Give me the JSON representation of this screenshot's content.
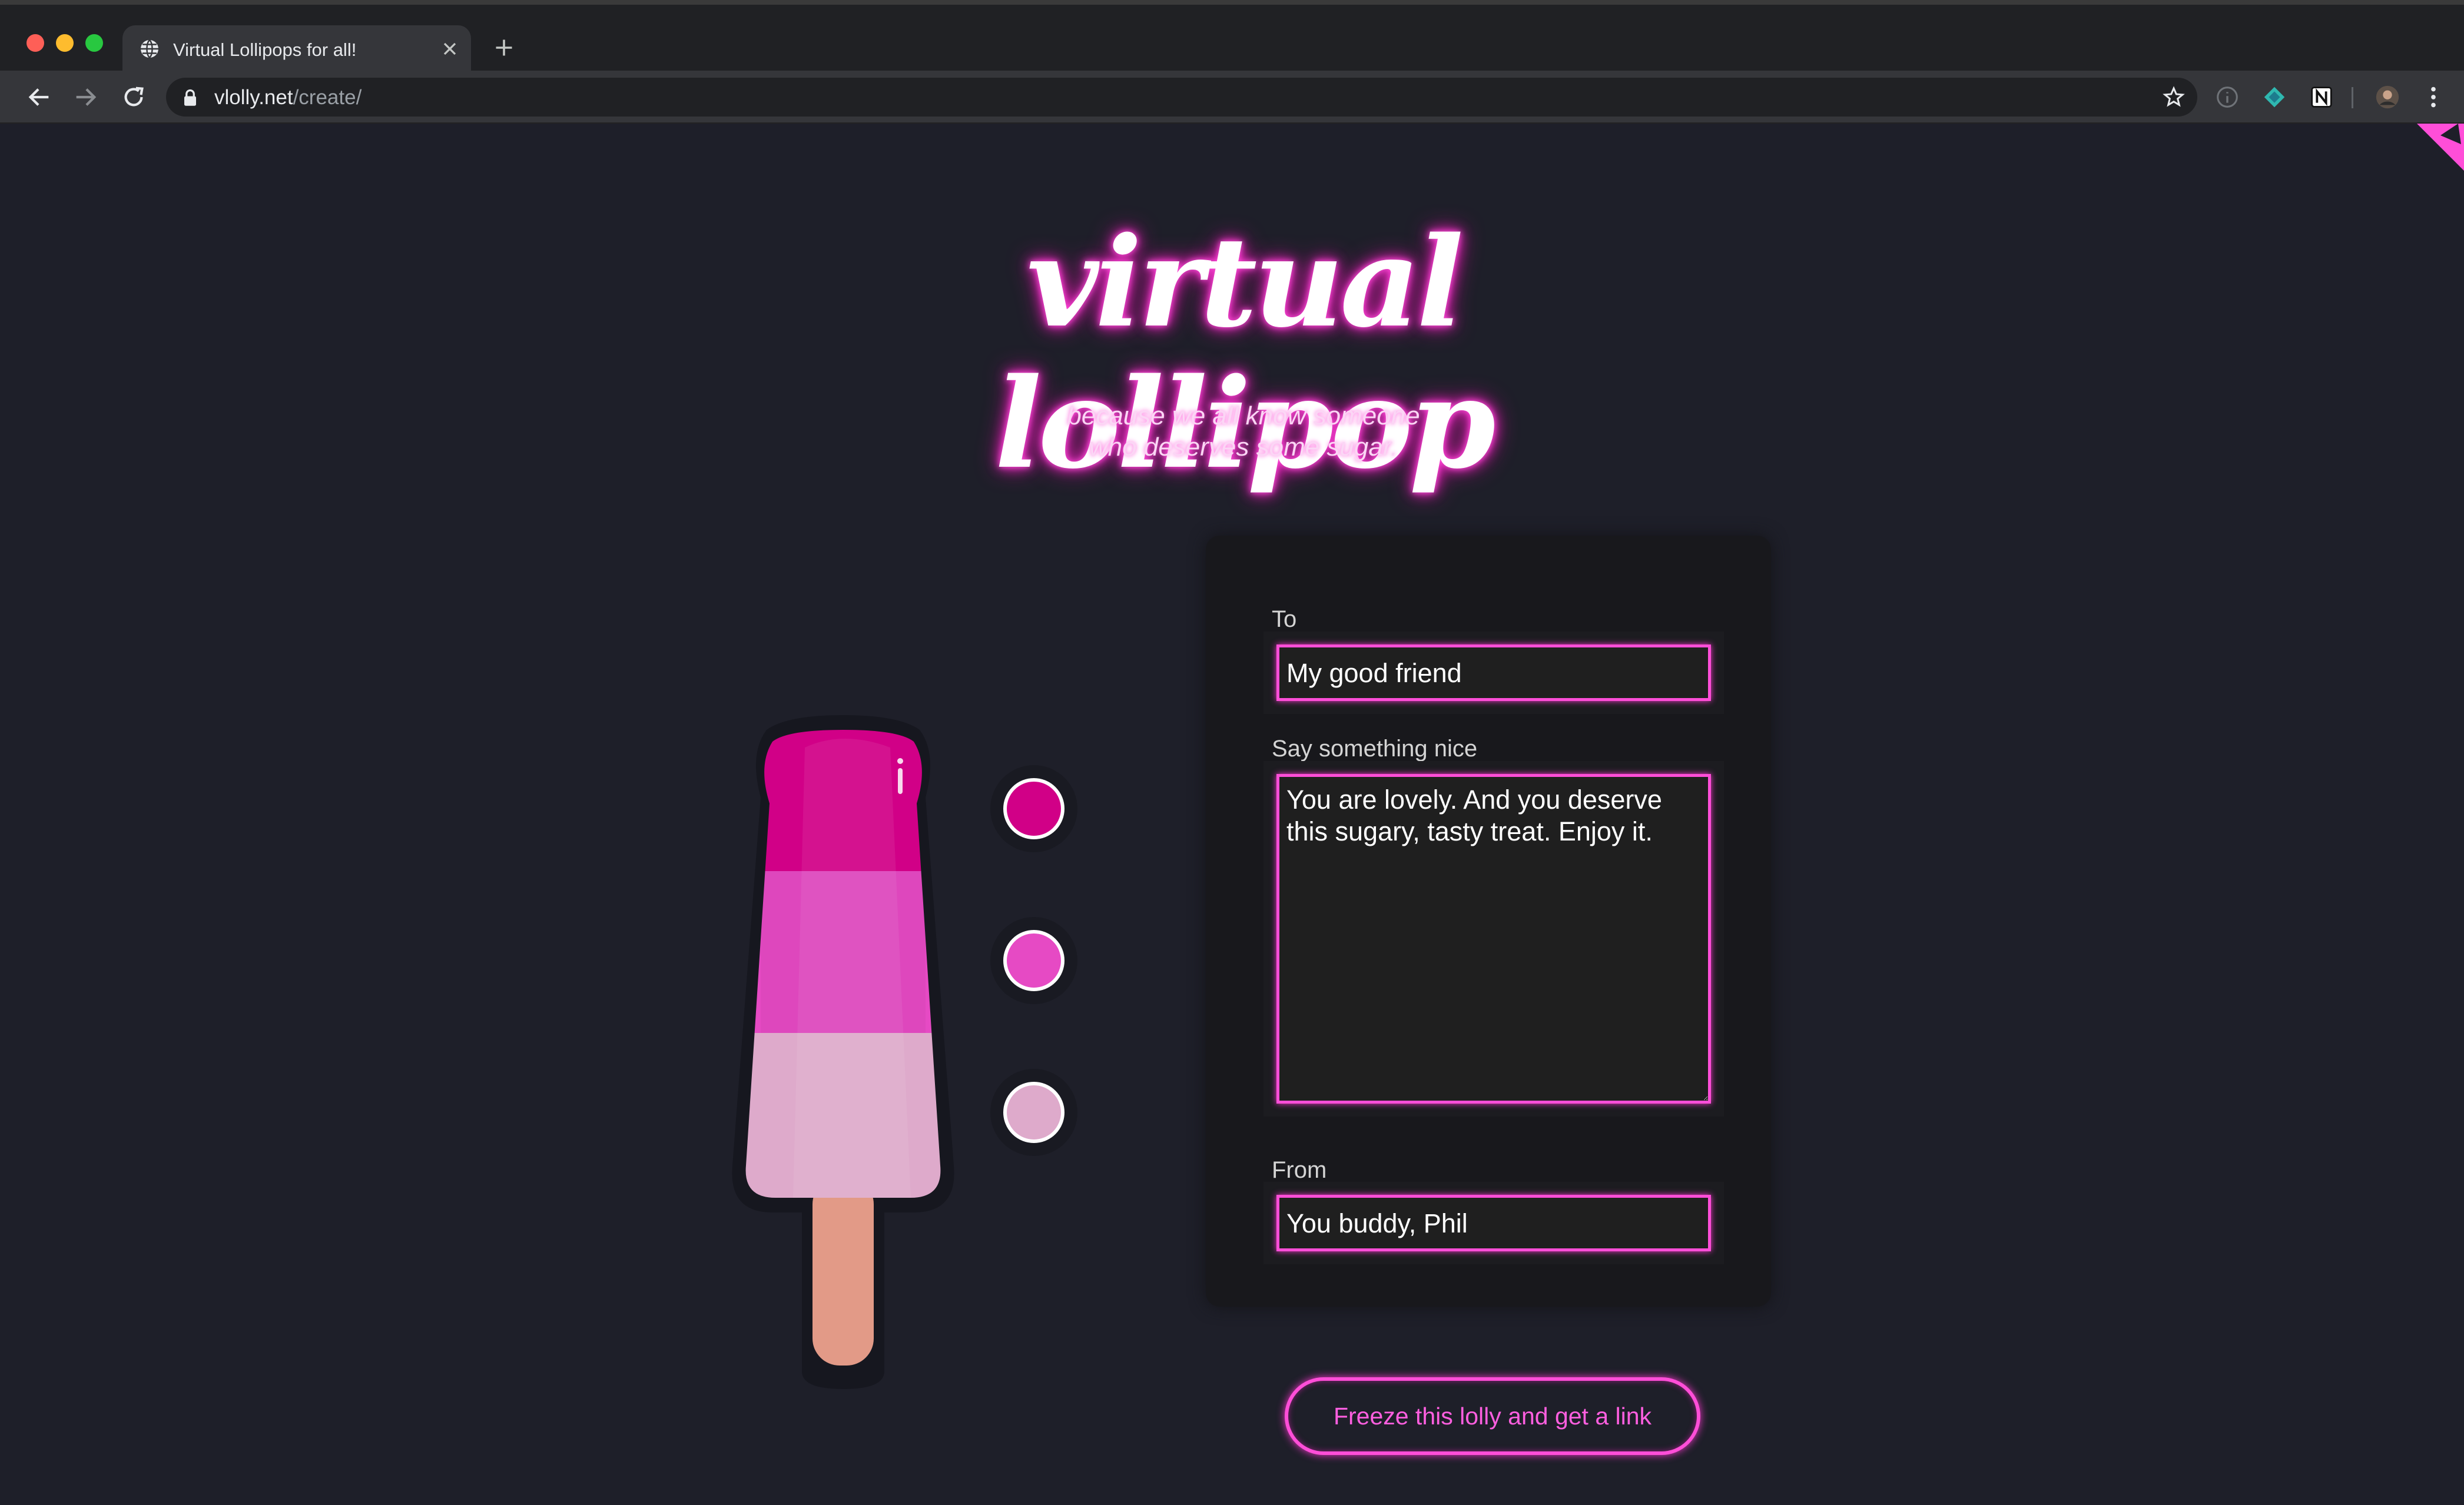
{
  "browser": {
    "tab_title": "Virtual Lollipops for all!",
    "url_host": "vlolly.net",
    "url_path": "/create/"
  },
  "page": {
    "title": "virtual lollipop",
    "subtitle_line1": "because we all know someone",
    "subtitle_line2": "who deserves some sugar."
  },
  "lolly": {
    "colors": {
      "top": "#d10087",
      "middle": "#e64ac4",
      "bottom": "#deaacb",
      "stick": "#e29a87"
    }
  },
  "form": {
    "to_label": "To",
    "to_value": "My good friend",
    "message_label": "Say something nice",
    "message_value": "You are lovely. And you deserve this sugary, tasty treat. Enjoy it.",
    "from_label": "From",
    "from_value": "You buddy, Phil",
    "submit_label": "Freeze this lolly and get a link"
  },
  "theme": {
    "accent": "#ff4ed8",
    "background": "#1e1f29"
  }
}
